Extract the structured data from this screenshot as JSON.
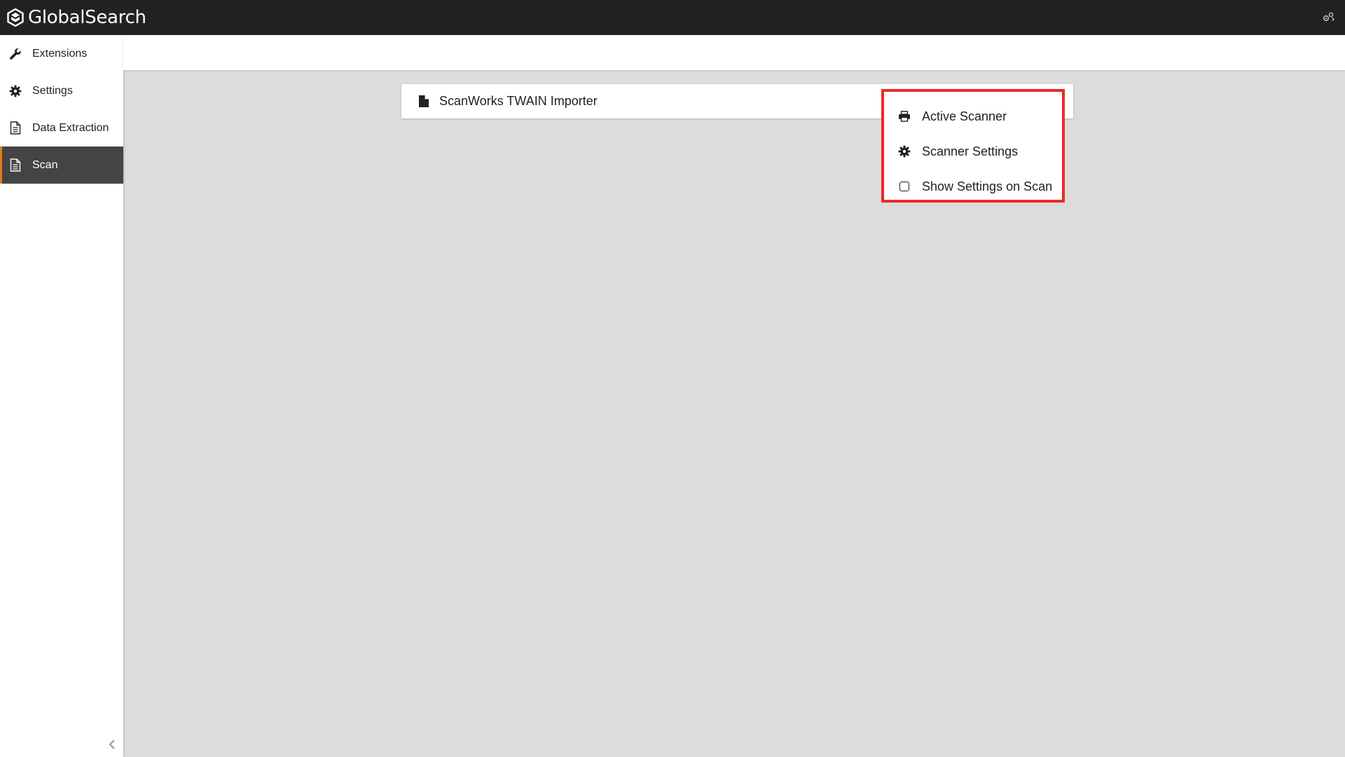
{
  "app": {
    "title": "GlobalSearch"
  },
  "sidebar": {
    "items": [
      {
        "label": "Extensions",
        "icon": "wrench-icon"
      },
      {
        "label": "Settings",
        "icon": "gear-icon"
      },
      {
        "label": "Data Extraction",
        "icon": "document-icon"
      },
      {
        "label": "Scan",
        "icon": "document-icon",
        "active": true
      }
    ]
  },
  "card": {
    "title": "ScanWorks TWAIN Importer",
    "icon": "file-icon"
  },
  "menu": {
    "items": [
      {
        "label": "Active Scanner",
        "icon": "printer-icon"
      },
      {
        "label": "Scanner Settings",
        "icon": "gear-icon"
      },
      {
        "label": "Show Settings on Scan",
        "icon": "checkbox-icon"
      }
    ]
  },
  "colors": {
    "topbar": "#222222",
    "active_item": "#444444",
    "accent": "#e27a1e",
    "highlight": "#ee2a24"
  }
}
